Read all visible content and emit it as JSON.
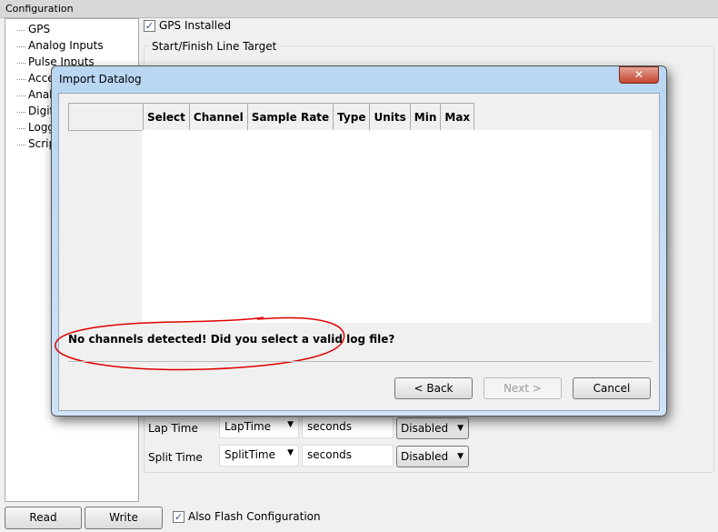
{
  "header": {
    "title": "Configuration"
  },
  "sidebar": {
    "items": [
      {
        "label": "GPS"
      },
      {
        "label": "Analog Inputs"
      },
      {
        "label": "Pulse Inputs"
      },
      {
        "label": "Acce"
      },
      {
        "label": "Analo"
      },
      {
        "label": "Digit"
      },
      {
        "label": "Logg"
      },
      {
        "label": "Scrip"
      }
    ]
  },
  "gps": {
    "installed_label": "GPS Installed",
    "installed": true,
    "group_title": "Start/Finish Line Target"
  },
  "channels": [
    {
      "label": "Lap Time",
      "channel": "LapTime",
      "units": "seconds",
      "mode": "Disabled"
    },
    {
      "label": "Split Time",
      "channel": "SplitTime",
      "units": "seconds",
      "mode": "Disabled"
    }
  ],
  "footer": {
    "read": "Read",
    "write": "Write",
    "flash_label": "Also Flash Configuration",
    "flash": true
  },
  "dialog": {
    "title": "Import Datalog",
    "close": "✕",
    "columns": [
      "",
      "Select",
      "Channel",
      "Sample Rate",
      "Type",
      "Units",
      "Min",
      "Max"
    ],
    "message": "No channels detected! Did you select a valid log file?",
    "back": "< Back",
    "next": "Next >",
    "cancel": "Cancel",
    "annotation_color": "#e00000"
  }
}
